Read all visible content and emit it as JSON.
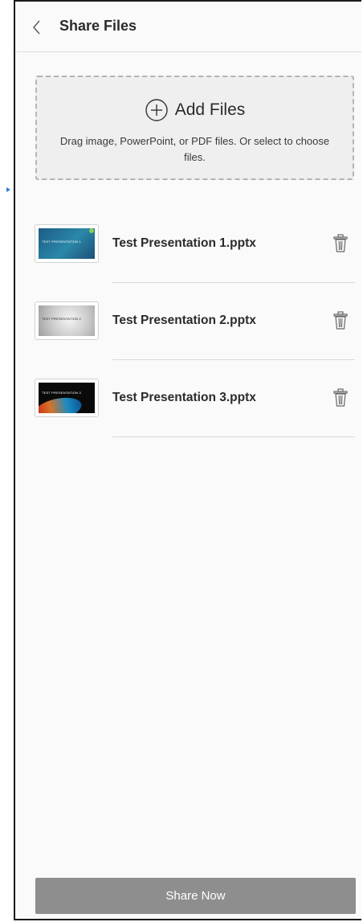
{
  "header": {
    "title": "Share Files",
    "back_icon": "chevron-left-icon"
  },
  "dropzone": {
    "icon": "plus-circle-icon",
    "label": "Add Files",
    "hint": "Drag image, PowerPoint, or PDF files. Or select to choose files."
  },
  "files": [
    {
      "name": "Test Presentation 1.pptx",
      "thumb_text": "TEST PRESENTATION 1",
      "delete_icon": "trash-icon"
    },
    {
      "name": "Test Presentation 2.pptx",
      "thumb_text": "TEST PRESENTATION 2",
      "delete_icon": "trash-icon"
    },
    {
      "name": "Test Presentation 3.pptx",
      "thumb_text": "TEST PRESENTATION 3",
      "delete_icon": "trash-icon"
    }
  ],
  "footer": {
    "share_label": "Share Now"
  },
  "colors": {
    "panel_bg": "#fafafa",
    "share_button_bg": "#8e8e8e",
    "dropzone_bg": "#efefef",
    "accent_arrow": "#2f7fd6"
  }
}
